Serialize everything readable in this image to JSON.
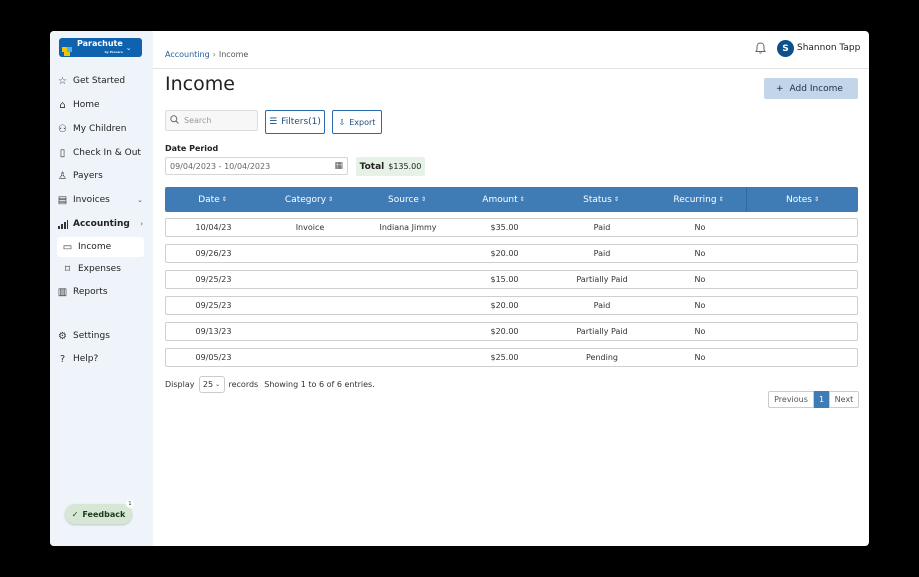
{
  "app": {
    "logo_text": "Parachute",
    "logo_sub": "by Procare",
    "user_initial": "S",
    "user_name": "Shannon Tapp",
    "brand_color": "#0f62ae",
    "accent_color": "#3f7bb5"
  },
  "sidebar": {
    "items": [
      {
        "label": "Get Started",
        "icon": "star-icon"
      },
      {
        "label": "Home",
        "icon": "home-icon"
      },
      {
        "label": "My Children",
        "icon": "children-icon"
      },
      {
        "label": "Check In & Out",
        "icon": "clipboard-icon"
      },
      {
        "label": "Payers",
        "icon": "person-icon"
      },
      {
        "label": "Invoices",
        "icon": "invoice-icon",
        "arrow": "v"
      },
      {
        "label": "Accounting",
        "icon": "chart-icon",
        "arrow": ">"
      },
      {
        "label": "Income",
        "icon": "money-icon",
        "active": true
      },
      {
        "label": "Expenses",
        "icon": "tag-icon"
      },
      {
        "label": "Reports",
        "icon": "report-icon"
      },
      {
        "label": "Settings",
        "icon": "gear-icon"
      },
      {
        "label": "Help?",
        "icon": "help-icon"
      }
    ],
    "feedback_label": "Feedback",
    "feedback_badge": "1"
  },
  "breadcrumb": {
    "parent": "Accounting",
    "current": "Income"
  },
  "page": {
    "title": "Income",
    "add_label": "Add Income",
    "search_placeholder": "Search",
    "filters_label": "Filters(1)",
    "export_label": "Export",
    "date_label": "Date Period",
    "date_value": "09/04/2023 - 10/04/2023",
    "total_label": "Total",
    "total_value": "$135.00"
  },
  "table": {
    "columns": [
      "Date",
      "Category",
      "Source",
      "Amount",
      "Status",
      "Recurring",
      "Notes"
    ],
    "rows": [
      [
        "10/04/23",
        "Invoice",
        "Indiana Jimmy",
        "$35.00",
        "Paid",
        "No",
        ""
      ],
      [
        "09/26/23",
        "",
        "",
        "$20.00",
        "Paid",
        "No",
        ""
      ],
      [
        "09/25/23",
        "",
        "",
        "$15.00",
        "Partially Paid",
        "No",
        ""
      ],
      [
        "09/25/23",
        "",
        "",
        "$20.00",
        "Paid",
        "No",
        ""
      ],
      [
        "09/13/23",
        "",
        "",
        "$20.00",
        "Partially Paid",
        "No",
        ""
      ],
      [
        "09/05/23",
        "",
        "",
        "$25.00",
        "Pending",
        "No",
        ""
      ]
    ]
  },
  "footer": {
    "display_label": "Display",
    "page_size": "25",
    "records_label": "records",
    "showing_text": "Showing 1 to 6 of 6 entries.",
    "prev_label": "Previous",
    "current_page": "1",
    "next_label": "Next"
  }
}
